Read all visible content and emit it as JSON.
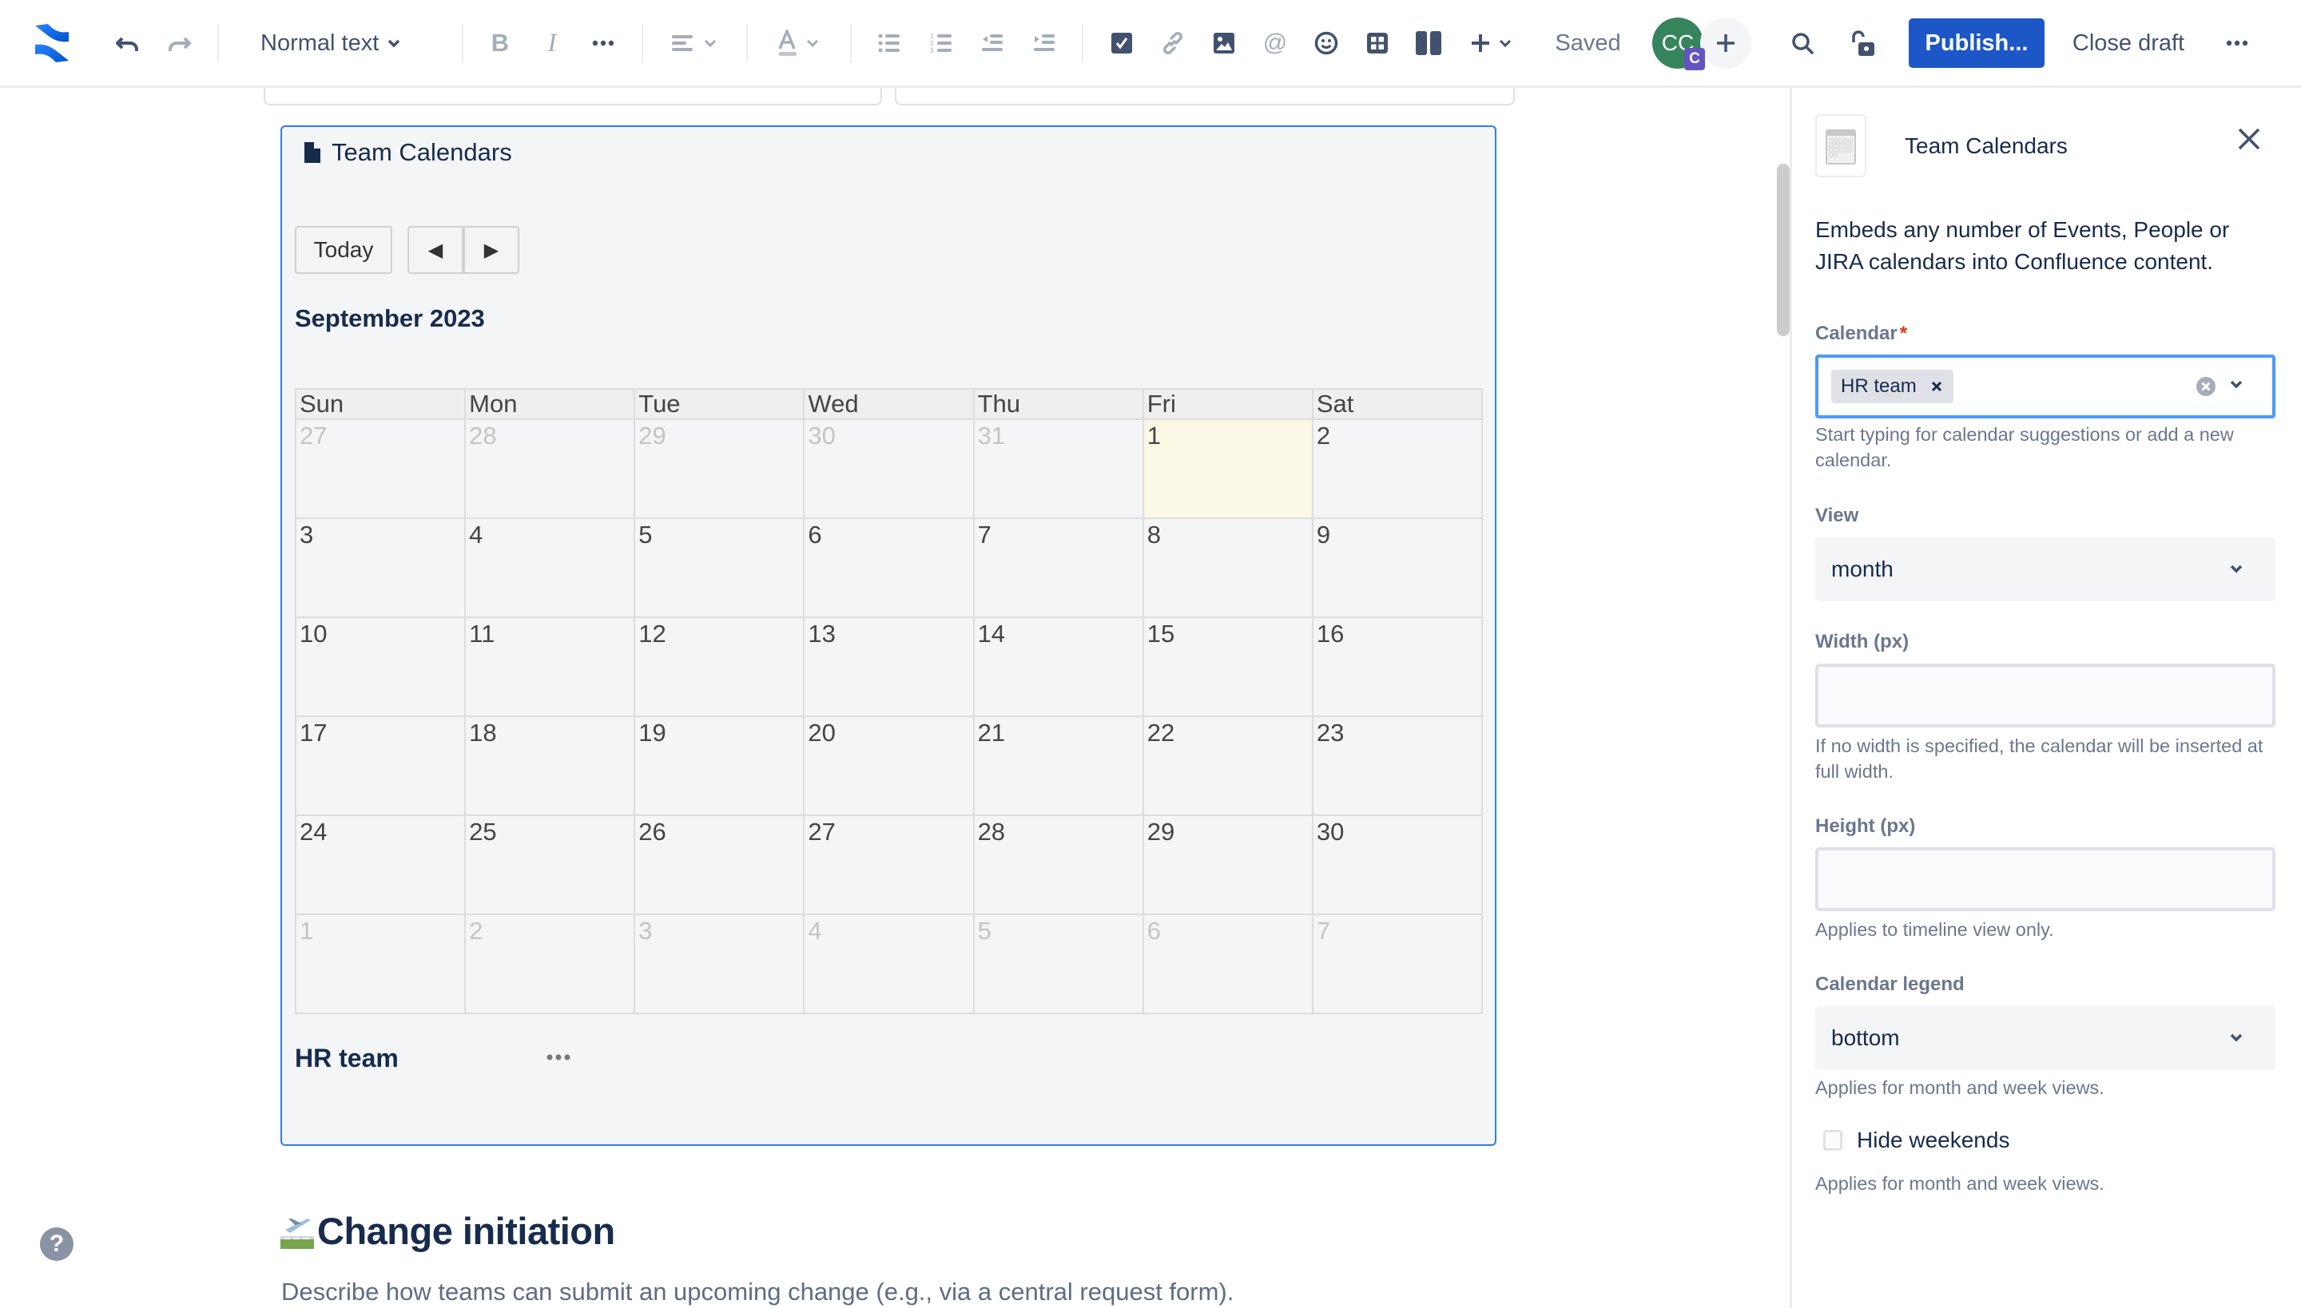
{
  "toolbar": {
    "text_style": "Normal text",
    "save_status": "Saved",
    "avatar_initials": "CC",
    "avatar_badge": "C",
    "publish_label": "Publish...",
    "close_draft_label": "Close draft",
    "colors": {
      "publish_bg": "#1d57c7",
      "avatar_bg": "#36845c",
      "badge_bg": "#6554c0"
    }
  },
  "macro": {
    "title": "Team Calendars",
    "today_label": "Today",
    "prev_label": "◀",
    "next_label": "▶",
    "month_title": "September 2023",
    "weekdays": [
      "Sun",
      "Mon",
      "Tue",
      "Wed",
      "Thu",
      "Fri",
      "Sat"
    ],
    "weeks": [
      [
        {
          "d": "27",
          "o": true
        },
        {
          "d": "28",
          "o": true
        },
        {
          "d": "29",
          "o": true
        },
        {
          "d": "30",
          "o": true
        },
        {
          "d": "31",
          "o": true
        },
        {
          "d": "1",
          "today": true
        },
        {
          "d": "2"
        }
      ],
      [
        {
          "d": "3"
        },
        {
          "d": "4"
        },
        {
          "d": "5"
        },
        {
          "d": "6"
        },
        {
          "d": "7"
        },
        {
          "d": "8"
        },
        {
          "d": "9"
        }
      ],
      [
        {
          "d": "10"
        },
        {
          "d": "11"
        },
        {
          "d": "12"
        },
        {
          "d": "13"
        },
        {
          "d": "14"
        },
        {
          "d": "15"
        },
        {
          "d": "16"
        }
      ],
      [
        {
          "d": "17"
        },
        {
          "d": "18"
        },
        {
          "d": "19"
        },
        {
          "d": "20"
        },
        {
          "d": "21"
        },
        {
          "d": "22"
        },
        {
          "d": "23"
        }
      ],
      [
        {
          "d": "24"
        },
        {
          "d": "25"
        },
        {
          "d": "26"
        },
        {
          "d": "27"
        },
        {
          "d": "28"
        },
        {
          "d": "29"
        },
        {
          "d": "30"
        }
      ],
      [
        {
          "d": "1",
          "o": true
        },
        {
          "d": "2",
          "o": true
        },
        {
          "d": "3",
          "o": true
        },
        {
          "d": "4",
          "o": true
        },
        {
          "d": "5",
          "o": true
        },
        {
          "d": "6",
          "o": true
        },
        {
          "d": "7",
          "o": true
        }
      ]
    ],
    "legend_name": "HR team",
    "colors": {
      "border": "#2f7cf0",
      "today_bg": "#fbf8e5"
    }
  },
  "content": {
    "heading": "Change initiation",
    "heading_emoji": "airplane-departure",
    "paragraph": "Describe how teams can submit an upcoming change (e.g., via a central request form)."
  },
  "panel": {
    "title": "Team Calendars",
    "description": "Embeds any number of Events, People or JIRA calendars into Confluence content.",
    "calendar": {
      "label": "Calendar",
      "required_mark": "*",
      "selected": [
        "HR team"
      ],
      "helper": "Start typing for calendar suggestions or add a new calendar."
    },
    "view": {
      "label": "View",
      "value": "month"
    },
    "width": {
      "label": "Width (px)",
      "value": "",
      "helper": "If no width is specified, the calendar will be inserted at full width."
    },
    "height": {
      "label": "Height (px)",
      "value": "",
      "helper": "Applies to timeline view only."
    },
    "legend": {
      "label": "Calendar legend",
      "value": "bottom",
      "helper": "Applies for month and week views."
    },
    "hide_weekends": {
      "label": "Hide weekends",
      "checked": false,
      "helper": "Applies for month and week views."
    }
  },
  "help_label": "?"
}
